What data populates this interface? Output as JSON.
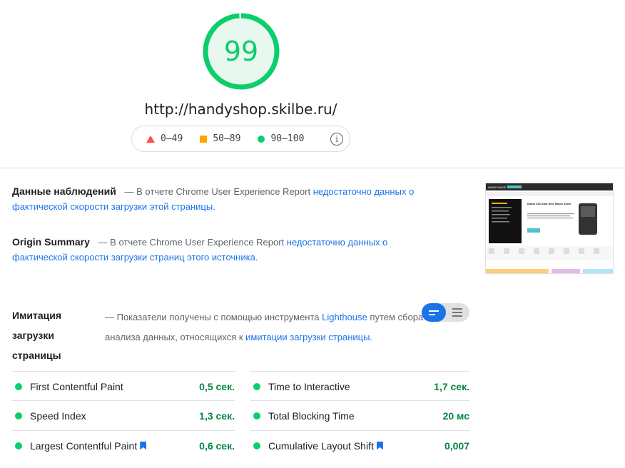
{
  "score": {
    "value": "99",
    "fraction": 0.99,
    "color": "#0cce6b"
  },
  "url": "http://handyshop.skilbe.ru/",
  "legend": [
    {
      "icon": "triangle-red-icon",
      "label": "0–49"
    },
    {
      "icon": "square-orange-icon",
      "label": "50–89"
    },
    {
      "icon": "circle-green-icon",
      "label": "90–100"
    }
  ],
  "field_data": {
    "title": "Данные наблюдений",
    "dash": "— В отчете Chrome User Experience Report",
    "link": "недостаточно данных о фактической скорости загрузки этой страницы",
    "end": "."
  },
  "origin_summary": {
    "title": "Origin Summary",
    "dash": "— В отчете Chrome User Experience Report",
    "link": "недостаточно данных о фактической скорости загрузки страниц этого источника",
    "end": "."
  },
  "lab": {
    "title": "Имитация загрузки страницы",
    "desc_a": "— Показатели получены с помощью инструмента",
    "desc_link1": "Lighthouse",
    "desc_b": "путем сбора анализа данных, относящихся к",
    "desc_link2": "имитации загрузки страницы",
    "desc_end": "."
  },
  "metrics": [
    {
      "name": "First Contentful Paint",
      "value": "0,5 сек.",
      "flag": false
    },
    {
      "name": "Time to Interactive",
      "value": "1,7 сек.",
      "flag": false
    },
    {
      "name": "Speed Index",
      "value": "1,3 сек.",
      "flag": false
    },
    {
      "name": "Total Blocking Time",
      "value": "20 мс",
      "flag": false
    },
    {
      "name": "Largest Contentful Paint",
      "value": "0,6 сек.",
      "flag": true
    },
    {
      "name": "Cumulative Layout Shift",
      "value": "0,007",
      "flag": true
    }
  ],
  "thumbnail": {
    "logo": "HANDYSHOP",
    "product_title": "Nokia 230 Dual Sim, Black Silver"
  }
}
